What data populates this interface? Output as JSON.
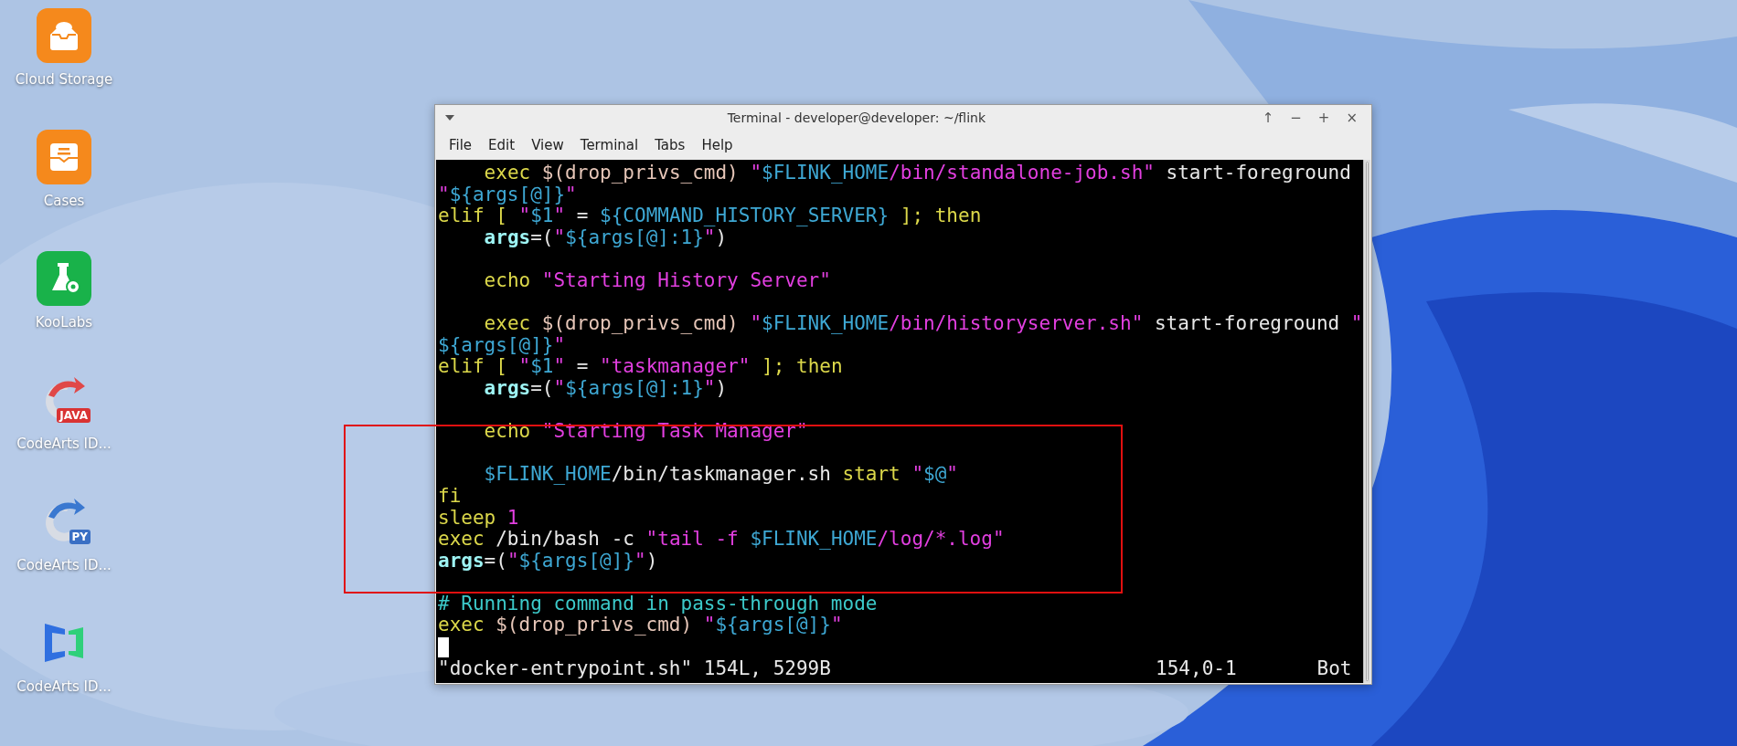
{
  "desktop_icons": [
    {
      "label": "Cloud Storage",
      "kind": "cloud"
    },
    {
      "label": "Cases",
      "kind": "cases"
    },
    {
      "label": "KooLabs",
      "kind": "lab"
    },
    {
      "label": "CodeArts ID...",
      "kind": "java",
      "badge": "JAVA"
    },
    {
      "label": "CodeArts ID...",
      "kind": "python",
      "badge": "PY"
    },
    {
      "label": "CodeArts ID...",
      "kind": "brackets"
    }
  ],
  "window": {
    "title": "Terminal - developer@developer: ~/flink",
    "controls": [
      "↑",
      "−",
      "+",
      "×"
    ]
  },
  "menu": [
    "File",
    "Edit",
    "View",
    "Terminal",
    "Tabs",
    "Help"
  ],
  "lines": [
    {
      "indent": true,
      "segments": [
        {
          "kind": "kw",
          "text": "exec "
        },
        {
          "kind": "sub",
          "text": "$(drop_privs_cmd) "
        },
        {
          "kind": "str",
          "text": "\""
        },
        {
          "kind": "var",
          "text": "$FLINK_HOME"
        },
        {
          "kind": "str",
          "text": "/bin/standalone-job.sh\""
        },
        {
          "kind": "plain",
          "text": " start-foreground"
        }
      ]
    },
    {
      "segments": [
        {
          "kind": "str",
          "text": "\""
        },
        {
          "kind": "var",
          "text": "${args[@]}"
        },
        {
          "kind": "str",
          "text": "\""
        }
      ]
    },
    {
      "segments": [
        {
          "kind": "kw",
          "text": "elif [ "
        },
        {
          "kind": "str",
          "text": "\""
        },
        {
          "kind": "var",
          "text": "$1"
        },
        {
          "kind": "str",
          "text": "\""
        },
        {
          "kind": "plain",
          "text": " = "
        },
        {
          "kind": "var",
          "text": "${COMMAND_HISTORY_SERVER}"
        },
        {
          "kind": "kw",
          "text": " ]; then"
        }
      ]
    },
    {
      "indent": true,
      "segments": [
        {
          "kind": "bold",
          "text": "args"
        },
        {
          "kind": "plain",
          "text": "=("
        },
        {
          "kind": "str",
          "text": "\""
        },
        {
          "kind": "var",
          "text": "${args[@]:1}"
        },
        {
          "kind": "str",
          "text": "\""
        },
        {
          "kind": "plain",
          "text": ")"
        }
      ]
    },
    {
      "kind": "blank"
    },
    {
      "indent": true,
      "segments": [
        {
          "kind": "kw",
          "text": "echo "
        },
        {
          "kind": "str",
          "text": "\"Starting History Server\""
        }
      ]
    },
    {
      "kind": "blank"
    },
    {
      "indent": true,
      "segments": [
        {
          "kind": "kw",
          "text": "exec "
        },
        {
          "kind": "sub",
          "text": "$(drop_privs_cmd) "
        },
        {
          "kind": "str",
          "text": "\""
        },
        {
          "kind": "var",
          "text": "$FLINK_HOME"
        },
        {
          "kind": "str",
          "text": "/bin/historyserver.sh\""
        },
        {
          "kind": "plain",
          "text": " start-foreground "
        },
        {
          "kind": "str",
          "text": "\""
        }
      ]
    },
    {
      "segments": [
        {
          "kind": "var",
          "text": "${args[@]}"
        },
        {
          "kind": "str",
          "text": "\""
        }
      ]
    },
    {
      "segments": [
        {
          "kind": "kw",
          "text": "elif [ "
        },
        {
          "kind": "str",
          "text": "\""
        },
        {
          "kind": "var",
          "text": "$1"
        },
        {
          "kind": "str",
          "text": "\""
        },
        {
          "kind": "plain",
          "text": " = "
        },
        {
          "kind": "str",
          "text": "\"taskmanager\""
        },
        {
          "kind": "kw",
          "text": " ]; then"
        }
      ]
    },
    {
      "indent": true,
      "segments": [
        {
          "kind": "bold",
          "text": "args"
        },
        {
          "kind": "plain",
          "text": "=("
        },
        {
          "kind": "str",
          "text": "\""
        },
        {
          "kind": "var",
          "text": "${args[@]:1}"
        },
        {
          "kind": "str",
          "text": "\""
        },
        {
          "kind": "plain",
          "text": ")"
        }
      ]
    },
    {
      "kind": "blank"
    },
    {
      "indent": true,
      "segments": [
        {
          "kind": "kw",
          "text": "echo "
        },
        {
          "kind": "str",
          "text": "\"Starting Task Manager\""
        }
      ]
    },
    {
      "kind": "blank"
    },
    {
      "indent": true,
      "segments": [
        {
          "kind": "var",
          "text": "$FLINK_HOME"
        },
        {
          "kind": "plain",
          "text": "/bin/taskmanager.sh "
        },
        {
          "kind": "kw",
          "text": "start "
        },
        {
          "kind": "str",
          "text": "\""
        },
        {
          "kind": "var",
          "text": "$@"
        },
        {
          "kind": "str",
          "text": "\""
        }
      ]
    },
    {
      "segments": [
        {
          "kind": "kw",
          "text": "fi"
        }
      ]
    },
    {
      "segments": [
        {
          "kind": "kw",
          "text": "sleep "
        },
        {
          "kind": "str",
          "text": "1"
        }
      ]
    },
    {
      "segments": [
        {
          "kind": "kw",
          "text": "exec "
        },
        {
          "kind": "plain",
          "text": "/bin/bash -c "
        },
        {
          "kind": "str",
          "text": "\"tail -f "
        },
        {
          "kind": "var",
          "text": "$FLINK_HOME"
        },
        {
          "kind": "str",
          "text": "/log/*.log\""
        }
      ]
    },
    {
      "segments": [
        {
          "kind": "bold",
          "text": "args"
        },
        {
          "kind": "plain",
          "text": "=("
        },
        {
          "kind": "str",
          "text": "\""
        },
        {
          "kind": "var",
          "text": "${args[@]}"
        },
        {
          "kind": "str",
          "text": "\""
        },
        {
          "kind": "plain",
          "text": ")"
        }
      ]
    },
    {
      "kind": "blank"
    },
    {
      "segments": [
        {
          "kind": "comment",
          "text": "# Running command in pass-through mode"
        }
      ]
    },
    {
      "segments": [
        {
          "kind": "kw",
          "text": "exec "
        },
        {
          "kind": "sub",
          "text": "$(drop_privs_cmd) "
        },
        {
          "kind": "str",
          "text": "\""
        },
        {
          "kind": "var",
          "text": "${args[@]}"
        },
        {
          "kind": "str",
          "text": "\""
        }
      ]
    },
    {
      "kind": "cursor"
    }
  ],
  "status": {
    "file": "\"docker-entrypoint.sh\" 154L, 5299B",
    "position": "154,0-1",
    "scroll": "Bot"
  }
}
